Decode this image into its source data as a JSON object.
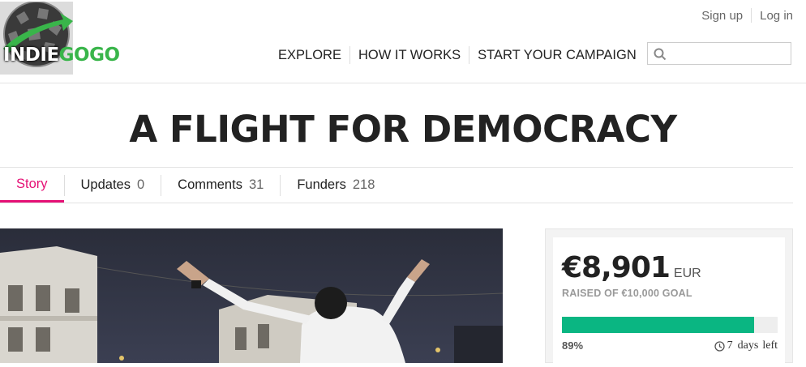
{
  "header": {
    "logo": {
      "part1": "INDIE",
      "part2": "GOGO"
    },
    "auth": {
      "signup": "Sign up",
      "login": "Log in"
    },
    "nav": [
      "EXPLORE",
      "HOW IT WORKS",
      "START YOUR CAMPAIGN"
    ],
    "search": {
      "placeholder": "",
      "value": ""
    }
  },
  "campaign": {
    "title": "A FLIGHT FOR DEMOCRACY"
  },
  "tabs": [
    {
      "label": "Story",
      "count": "",
      "active": true
    },
    {
      "label": "Updates",
      "count": "0"
    },
    {
      "label": "Comments",
      "count": "31"
    },
    {
      "label": "Funders",
      "count": "218"
    }
  ],
  "funding": {
    "amount": "€8,901",
    "currency": "EUR",
    "goal_text": "RAISED OF €10,000 GOAL",
    "percent_label": "89%",
    "progress": 0.89,
    "days_left": "7",
    "days_word": "days",
    "left_word": "left"
  },
  "colors": {
    "accent_pink": "#e51075",
    "progress_green": "#0ab682",
    "logo_green": "#39b54a"
  }
}
